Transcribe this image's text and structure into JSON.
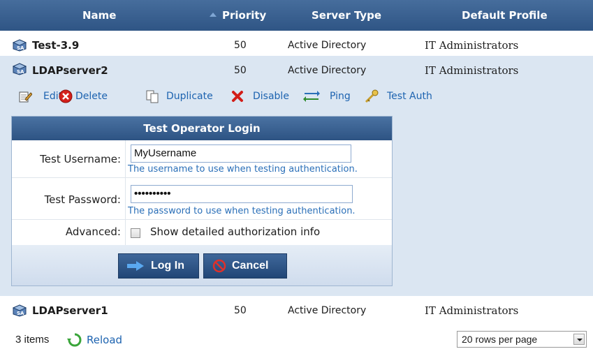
{
  "table": {
    "columns": {
      "name": "Name",
      "priority": "Priority",
      "server_type": "Server Type",
      "default_profile": "Default Profile"
    },
    "rows": [
      {
        "name": "Test-3.9",
        "priority": "50",
        "server_type": "Active Directory",
        "default_profile": "IT Administrators"
      },
      {
        "name": "LDAPserver2",
        "priority": "50",
        "server_type": "Active Directory",
        "default_profile": "IT Administrators"
      },
      {
        "name": "LDAPserver1",
        "priority": "50",
        "server_type": "Active Directory",
        "default_profile": "IT Administrators"
      }
    ]
  },
  "toolbar": {
    "edit": "Edit",
    "delete": "Delete",
    "duplicate": "Duplicate",
    "disable": "Disable",
    "ping": "Ping",
    "test_auth": "Test Auth"
  },
  "dialog": {
    "title": "Test Operator Login",
    "username_label": "Test Username:",
    "username_value": "MyUsername",
    "username_hint": "The username to use when testing authentication.",
    "password_label": "Test Password:",
    "password_value": "••••••••••",
    "password_hint": "The password to use when testing authentication.",
    "advanced_label": "Advanced:",
    "advanced_checkbox": "Show detailed authorization info",
    "login_button": "Log In",
    "cancel_button": "Cancel"
  },
  "footer": {
    "item_count": "3 items",
    "reload": "Reload",
    "rows_per_page": "20 rows per page"
  },
  "icons": {
    "server": "server-icon",
    "edit": "edit-icon",
    "delete": "delete-icon",
    "duplicate": "duplicate-icon",
    "disable": "disable-icon",
    "ping": "ping-icon",
    "test_auth": "key-icon",
    "login": "arrow-right-icon",
    "cancel": "cancel-icon",
    "reload": "reload-icon"
  },
  "colors": {
    "header": "#36609a",
    "selected_row": "#dbe6f2",
    "link": "#1d63b0",
    "hint": "#2a6fb8"
  }
}
